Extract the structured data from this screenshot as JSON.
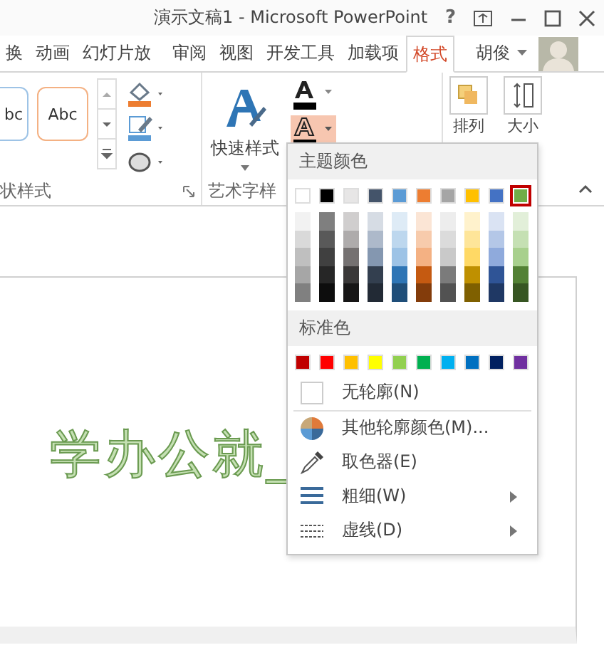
{
  "window": {
    "title": "演示文稿1 - Microsoft PowerPoint",
    "help": "?"
  },
  "tabs": [
    {
      "label": "换",
      "selected": false
    },
    {
      "label": "动画",
      "selected": false
    },
    {
      "label": "幻灯片放",
      "selected": false
    },
    {
      "label": "审阅",
      "selected": false
    },
    {
      "label": "视图",
      "selected": false
    },
    {
      "label": "开发工具",
      "selected": false
    },
    {
      "label": "加载项",
      "selected": false
    },
    {
      "label": "格式",
      "selected": true
    }
  ],
  "user": {
    "name": "胡俊"
  },
  "ribbon": {
    "shape_styles": {
      "label": "状样式",
      "thumbnails": [
        "bc",
        "Abc"
      ]
    },
    "wordart_styles": {
      "label": "艺术字样",
      "quick_styles": "快速样式",
      "text_outline_pressed": true
    },
    "arrange": "排列",
    "size": "大小"
  },
  "slide": {
    "text": "学办公就_"
  },
  "menu": {
    "theme_header": "主题颜色",
    "theme_colors": [
      {
        "color": "#ffffff",
        "selected": false,
        "shades": [
          {
            "color": "#f2f2f2"
          },
          {
            "color": "#d9d9d9"
          },
          {
            "color": "#bfbfbf"
          },
          {
            "color": "#a6a6a6"
          },
          {
            "color": "#808080"
          }
        ]
      },
      {
        "color": "#000000",
        "selected": false,
        "shades": [
          {
            "color": "#7f7f7f"
          },
          {
            "color": "#595959"
          },
          {
            "color": "#404040"
          },
          {
            "color": "#262626"
          },
          {
            "color": "#0d0d0d"
          }
        ]
      },
      {
        "color": "#e7e6e6",
        "selected": false,
        "shades": [
          {
            "color": "#d0cece"
          },
          {
            "color": "#aeabab"
          },
          {
            "color": "#757171"
          },
          {
            "color": "#3a3838"
          },
          {
            "color": "#171616"
          }
        ]
      },
      {
        "color": "#44546a",
        "selected": false,
        "shades": [
          {
            "color": "#d6dce4"
          },
          {
            "color": "#adb9ca"
          },
          {
            "color": "#8497b0"
          },
          {
            "color": "#333f4f"
          },
          {
            "color": "#222a35"
          }
        ]
      },
      {
        "color": "#5b9bd5",
        "selected": false,
        "shades": [
          {
            "color": "#deebf6"
          },
          {
            "color": "#bdd7ee"
          },
          {
            "color": "#9dc3e6"
          },
          {
            "color": "#2e75b5"
          },
          {
            "color": "#1f4e79"
          }
        ]
      },
      {
        "color": "#ed7d31",
        "selected": false,
        "shades": [
          {
            "color": "#fbe5d5"
          },
          {
            "color": "#f7cbac"
          },
          {
            "color": "#f4b183"
          },
          {
            "color": "#c55a11"
          },
          {
            "color": "#833c0b"
          }
        ]
      },
      {
        "color": "#a5a5a5",
        "selected": false,
        "shades": [
          {
            "color": "#ededed"
          },
          {
            "color": "#dbdbdb"
          },
          {
            "color": "#c9c9c9"
          },
          {
            "color": "#7b7b7b"
          },
          {
            "color": "#525252"
          }
        ]
      },
      {
        "color": "#ffc000",
        "selected": false,
        "shades": [
          {
            "color": "#fff2cc"
          },
          {
            "color": "#fee599"
          },
          {
            "color": "#ffd965"
          },
          {
            "color": "#bf9000"
          },
          {
            "color": "#7f6000"
          }
        ]
      },
      {
        "color": "#4472c4",
        "selected": false,
        "shades": [
          {
            "color": "#dae3f3"
          },
          {
            "color": "#b4c7e7"
          },
          {
            "color": "#8faadc"
          },
          {
            "color": "#2f5496"
          },
          {
            "color": "#1f3864"
          }
        ]
      },
      {
        "color": "#70ad47",
        "selected": true,
        "shades": [
          {
            "color": "#e2efd9"
          },
          {
            "color": "#c5e0b3"
          },
          {
            "color": "#a8d08d"
          },
          {
            "color": "#538135"
          },
          {
            "color": "#375623"
          }
        ]
      }
    ],
    "standard_header": "标准色",
    "standard_colors": [
      {
        "color": "#c00000"
      },
      {
        "color": "#ff0000"
      },
      {
        "color": "#ffc000"
      },
      {
        "color": "#ffff00"
      },
      {
        "color": "#92d050"
      },
      {
        "color": "#00b050"
      },
      {
        "color": "#00b0f0"
      },
      {
        "color": "#0070c0"
      },
      {
        "color": "#002060"
      },
      {
        "color": "#7030a0"
      }
    ],
    "items": [
      {
        "kind": "no-outline",
        "label": "无轮廓(N)",
        "submenu": false
      },
      {
        "kind": "palette",
        "label": "其他轮廓颜色(M)...",
        "submenu": false
      },
      {
        "kind": "eyedropper",
        "label": "取色器(E)",
        "submenu": false
      },
      {
        "kind": "weight",
        "label": "粗细(W)",
        "submenu": true
      },
      {
        "kind": "dash",
        "label": "虚线(D)",
        "submenu": true
      }
    ]
  }
}
